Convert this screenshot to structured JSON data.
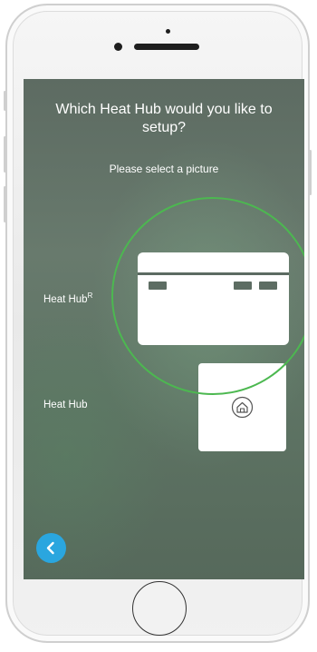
{
  "screen": {
    "title": "Which Heat Hub would you like to setup?",
    "subtitle": "Please select a picture",
    "options": [
      {
        "label": "Heat Hub",
        "superscript": "R",
        "selected": true
      },
      {
        "label": "Heat Hub",
        "superscript": "",
        "selected": false
      }
    ],
    "back_button_icon": "chevron-left-icon",
    "device_icon": "home-icon"
  },
  "colors": {
    "highlight": "#4cb850",
    "back_button": "#2aa6df"
  }
}
